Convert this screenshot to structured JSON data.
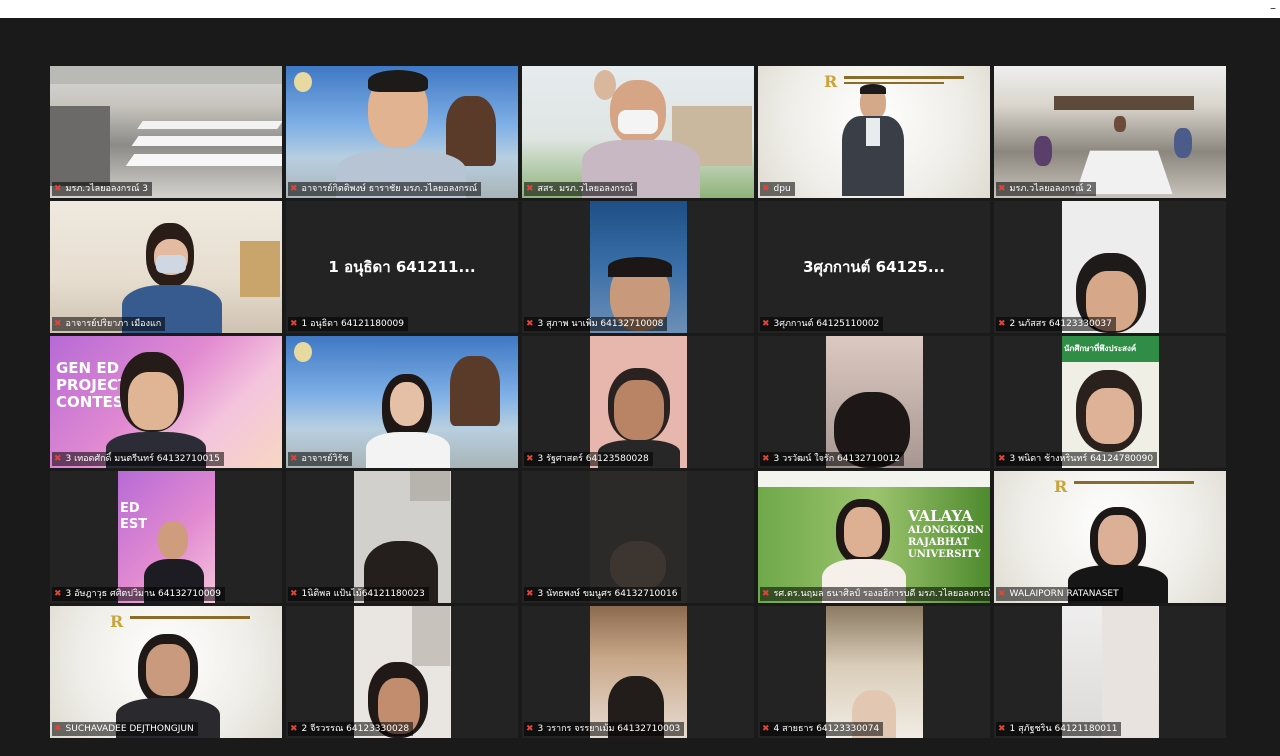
{
  "window": {
    "minimize_glyph": "–"
  },
  "colors": {
    "active_speaker_border": "#e6d34a",
    "mic_muted": "#e0453a",
    "background": "#1a1a1a",
    "tile": "#232323"
  },
  "tiles": [
    {
      "label": "มรภ.วไลยอลงกรณ์ 3",
      "big_name": "",
      "active": false
    },
    {
      "label": "อาจารย์กิตติพงษ์ ธาราชัย มรภ.วไลยอลงกรณ์",
      "big_name": "",
      "active": false
    },
    {
      "label": "สสร. มรภ.วไลยอลงกรณ์",
      "big_name": "",
      "active": false
    },
    {
      "label": "dpu",
      "big_name": "",
      "active": true
    },
    {
      "label": "มรภ.วไลยอลงกรณ์ 2",
      "big_name": "",
      "active": false
    },
    {
      "label": "อาจารย์ปริยาภา เมืองแก",
      "big_name": "",
      "active": false
    },
    {
      "label": "1 อนุธิดา 64121180009",
      "big_name": "1 อนุธิดา 641211...",
      "active": false
    },
    {
      "label": "3 สุภาพ นาเพิ่ม 64132710008",
      "big_name": "",
      "active": false
    },
    {
      "label": "3ศุภกานต์ 64125110002",
      "big_name": "3ศุภกานต์  64125...",
      "active": false
    },
    {
      "label": "2 นภัสสร 64123330037",
      "big_name": "",
      "active": false
    },
    {
      "label": "3 เทอดศักดิ์ มนตรีนทร์ 64132710015",
      "big_name": "",
      "active": false
    },
    {
      "label": "อาจารย์วิรัช",
      "big_name": "",
      "active": false
    },
    {
      "label": "3 รัฐศาสตร์ 64123580028",
      "big_name": "",
      "active": false
    },
    {
      "label": "3 วรวัฒน์ ใจรัก 64132710012",
      "big_name": "",
      "active": false
    },
    {
      "label": "3 พนิดา ช้างหรินทร์ 64124780090",
      "big_name": "",
      "active": false
    },
    {
      "label": "3 อัษฎาวุธ ศศิตปวิมาน 64132710009",
      "big_name": "",
      "active": false
    },
    {
      "label": "1นิติพล แป้นไม้64121180023",
      "big_name": "",
      "active": false
    },
    {
      "label": "3 นัทธพงษ์ ขมนูศร 64132710016",
      "big_name": "",
      "active": false
    },
    {
      "label": "รศ.ดร.นฤมล ธนาศิลป์ รองอธิการบดี มรภ.วไลยอลงกรณ์",
      "big_name": "",
      "active": false
    },
    {
      "label": "WALAIPORN RATANASET",
      "big_name": "",
      "active": false
    },
    {
      "label": "SUCHAVADEE DEJTHONGJUN",
      "big_name": "",
      "active": false
    },
    {
      "label": "2 จีรวรรณ 64123330028",
      "big_name": "",
      "active": false
    },
    {
      "label": "3 วรากร จรรยาเม้ม 64132710003",
      "big_name": "",
      "active": false
    },
    {
      "label": "4 สายธาร 64123330074",
      "big_name": "",
      "active": false
    },
    {
      "label": "1 สุภัฐชริน 64121180011",
      "big_name": "",
      "active": false
    }
  ],
  "backdrops": {
    "gen_ed_1": "GEN ED PROJECT CONTEST",
    "gen_ed_2": "ED EST",
    "valaya_1": "VALAYA",
    "valaya_2": "ALONGKORN",
    "valaya_3": "RAJABHAT",
    "valaya_4": "UNIVERSITY",
    "poster_title": "นักศึกษาที่พึงประสงค์"
  }
}
